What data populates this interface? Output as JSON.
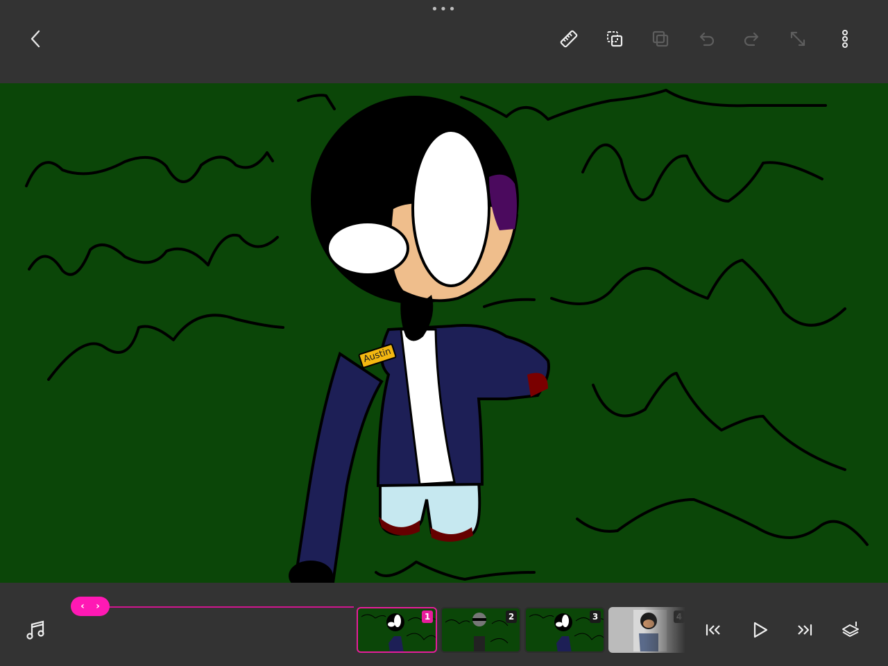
{
  "toolbar": {
    "back_icon": "chevron-left-icon",
    "tools": [
      {
        "name": "ruler-icon",
        "enabled": true
      },
      {
        "name": "copy-frame-icon",
        "enabled": true
      },
      {
        "name": "layers-icon",
        "enabled": false
      },
      {
        "name": "undo-icon",
        "enabled": false
      },
      {
        "name": "redo-icon",
        "enabled": false
      },
      {
        "name": "resize-icon",
        "enabled": false
      },
      {
        "name": "more-vertical-icon",
        "enabled": true
      }
    ]
  },
  "canvas": {
    "background_color": "#0b4608",
    "character_name_tag": "Austin"
  },
  "timeline": {
    "accent_color": "#ff19b4",
    "frames": [
      {
        "number": "1",
        "selected": true
      },
      {
        "number": "2",
        "selected": false
      },
      {
        "number": "3",
        "selected": false
      },
      {
        "number": "4",
        "selected": false
      }
    ]
  },
  "playback": [
    "skip-to-start-icon",
    "play-icon",
    "skip-to-end-icon",
    "onion-skin-icon"
  ]
}
